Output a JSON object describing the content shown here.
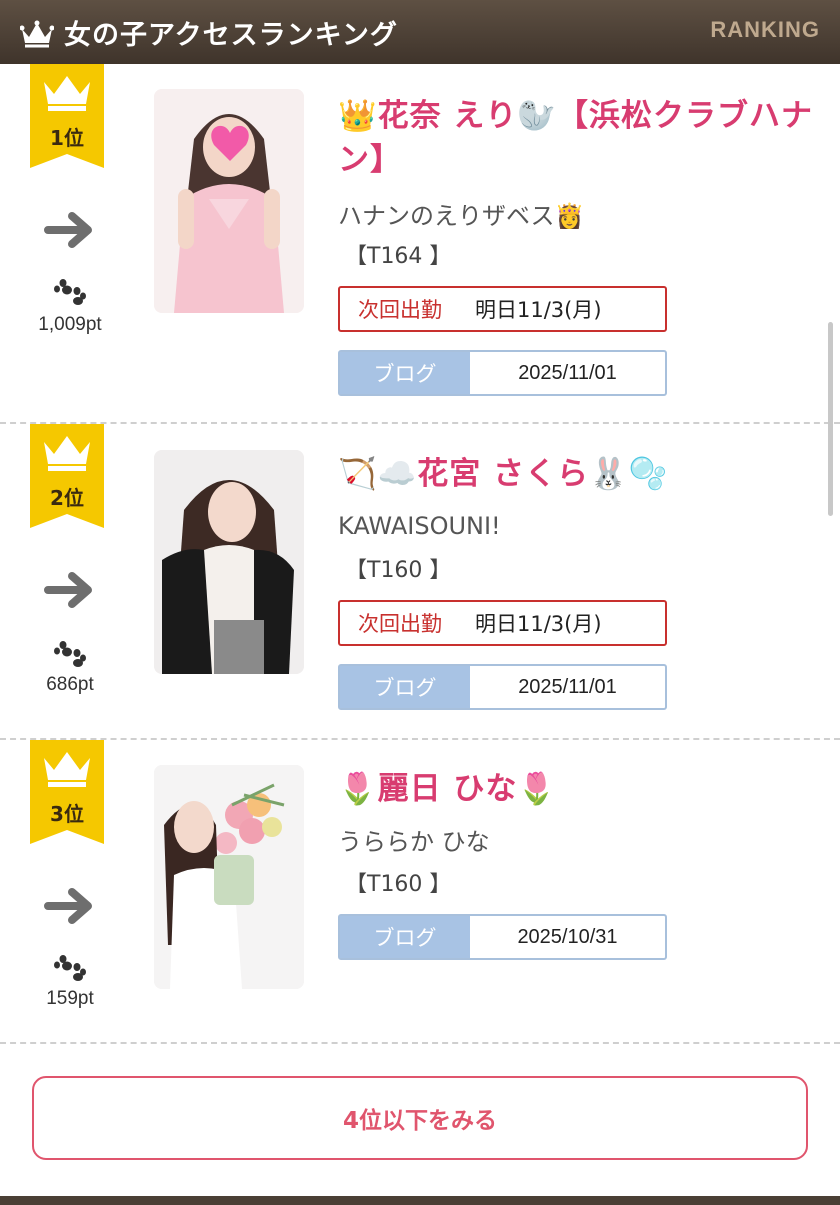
{
  "header": {
    "title": "女の子アクセスランキング",
    "subtitle": "RANKING",
    "icon": "crown-icon"
  },
  "colors": {
    "header_bg": "#4a3f35",
    "name": "#d83c70",
    "ribbon": "#f5c800",
    "next_border": "#c8302e",
    "blog_label_bg": "#a8c3e4",
    "more_border": "#e0556d"
  },
  "entries": [
    {
      "rank": "1位",
      "trend_icon": "arrow-right-icon",
      "points": "1,009pt",
      "name": "👑花奈 えり🦭【浜松クラブハナン】",
      "catch": "ハナンのえりザベス👸",
      "height": "【T164 】",
      "next_label": "次回出勤",
      "next_value": "明日11/3(月)",
      "blog_label": "ブログ",
      "blog_date": "2025/11/01"
    },
    {
      "rank": "2位",
      "trend_icon": "arrow-right-icon",
      "points": "686pt",
      "name": "🏹☁️花宮 さくら🐰🫧",
      "catch": "KAWAISOUNI!",
      "height": "【T160 】",
      "next_label": "次回出勤",
      "next_value": "明日11/3(月)",
      "blog_label": "ブログ",
      "blog_date": "2025/11/01"
    },
    {
      "rank": "3位",
      "trend_icon": "arrow-right-icon",
      "points": "159pt",
      "name": "🌷麗日 ひな🌷",
      "catch": "うららか ひな",
      "height": "【T160 】",
      "blog_label": "ブログ",
      "blog_date": "2025/10/31"
    }
  ],
  "more_button": {
    "label": "4位以下をみる"
  }
}
